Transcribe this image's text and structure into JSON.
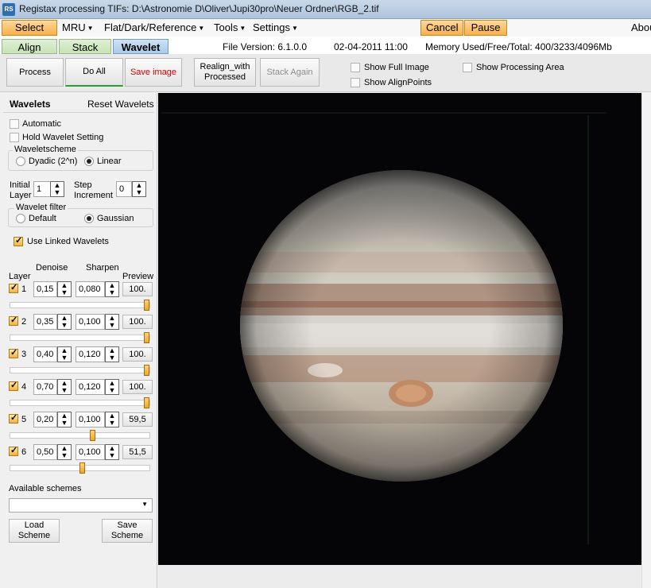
{
  "window": {
    "title": "Registax processing TIFs: D:\\Astronomie D\\Oliver\\Jupi30pro\\Neuer Ordner\\RGB_2.tif",
    "icon_text": "RS"
  },
  "menubar": {
    "select": "Select",
    "mru": "MRU",
    "flat": "Flat/Dark/Reference",
    "tools": "Tools",
    "settings": "Settings",
    "cancel": "Cancel",
    "pause": "Pause",
    "about": "About"
  },
  "tabs": {
    "align": "Align",
    "stack": "Stack",
    "wavelet": "Wavelet"
  },
  "info": {
    "file_version": "File Version: 6.1.0.0",
    "date": "02-04-2011 11:00",
    "memory": "Memory Used/Free/Total: 400/3233/4096Mb"
  },
  "toolbar": {
    "process": "Process",
    "do_all": "Do All",
    "save_image": "Save image",
    "realign_line1": "Realign_with",
    "realign_line2": "Processed",
    "stack_again": "Stack Again",
    "show_full_image": "Show Full Image",
    "show_alignpoints": "Show AlignPoints",
    "show_processing_area": "Show Processing Area"
  },
  "panel": {
    "title": "Wavelets",
    "reset": "Reset Wavelets",
    "automatic": "Automatic",
    "hold": "Hold Wavelet Setting",
    "scheme_label": "Waveletscheme",
    "dyadic": "Dyadic (2^n)",
    "linear": "Linear",
    "initial": "Initial",
    "layer": "Layer",
    "initial_value": "1",
    "step": "Step",
    "increment": "Increment",
    "step_value": "0",
    "filter_label": "Wavelet filter",
    "default": "Default",
    "gaussian": "Gaussian",
    "use_linked": "Use Linked Wavelets",
    "col_layer": "Layer",
    "col_denoise": "Denoise",
    "col_sharpen": "Sharpen",
    "col_preview": "Preview",
    "layers": [
      {
        "n": "1",
        "denoise": "0,15",
        "sharpen": "0,080",
        "preview": "100.",
        "level": 1.0
      },
      {
        "n": "2",
        "denoise": "0,35",
        "sharpen": "0,100",
        "preview": "100.",
        "level": 1.0
      },
      {
        "n": "3",
        "denoise": "0,40",
        "sharpen": "0,120",
        "preview": "100.",
        "level": 1.0
      },
      {
        "n": "4",
        "denoise": "0,70",
        "sharpen": "0,120",
        "preview": "100.",
        "level": 1.0
      },
      {
        "n": "5",
        "denoise": "0,20",
        "sharpen": "0,100",
        "preview": "59,5",
        "level": 0.595
      },
      {
        "n": "6",
        "denoise": "0,50",
        "sharpen": "0,100",
        "preview": "51,5",
        "level": 0.515
      }
    ],
    "available": "Available schemes",
    "load_1": "Load",
    "load_2": "Scheme",
    "save_1": "Save",
    "save_2": "Scheme"
  }
}
